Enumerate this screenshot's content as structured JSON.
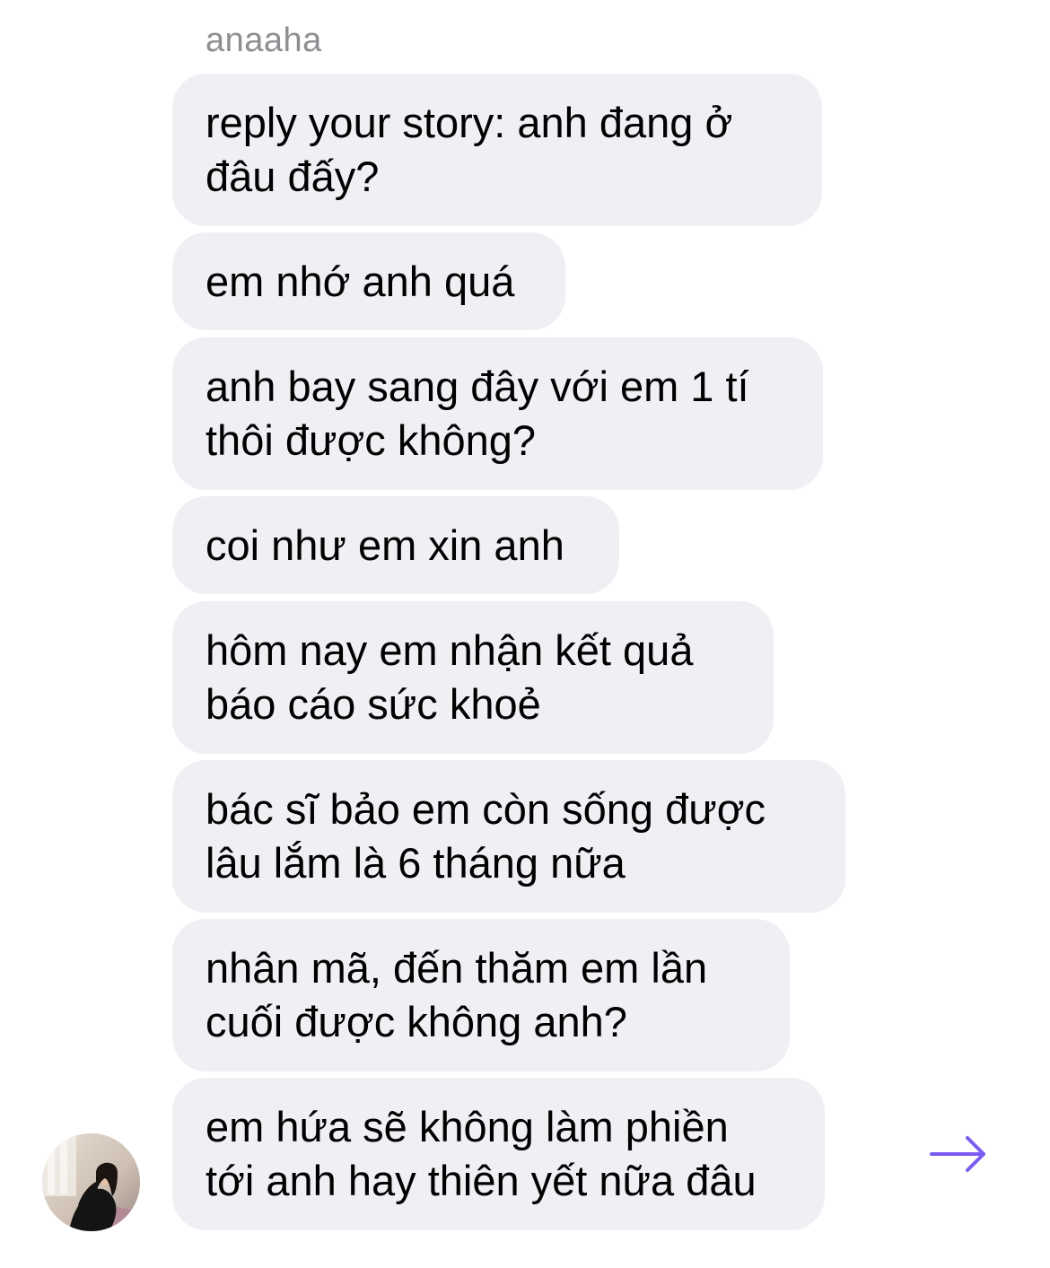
{
  "sender": {
    "name": "anaaha"
  },
  "messages": [
    {
      "text": "reply your story: anh đang ở\nđâu đấy?"
    },
    {
      "text": "em nhớ anh quá"
    },
    {
      "text": "anh bay sang đây với em 1 tí\nthôi được không?"
    },
    {
      "text": "coi như em xin anh"
    },
    {
      "text": "hôm nay em nhận kết quả\nbáo cáo sức khoẻ"
    },
    {
      "text": "bác sĩ bảo em còn sống được\nlâu lắm là 6 tháng nữa"
    },
    {
      "text": "nhân mã, đến thăm em lần\ncuối được không anh?"
    },
    {
      "text": "em hứa sẽ không làm phiền\ntới anh hay thiên yết nữa đâu"
    }
  ],
  "icons": {
    "avatar": "contact-avatar-photo",
    "action": "arrow-right-icon"
  },
  "colors": {
    "bubble": "#efeff4",
    "sender": "#8e8e93",
    "accent": "#7b5cf0"
  }
}
